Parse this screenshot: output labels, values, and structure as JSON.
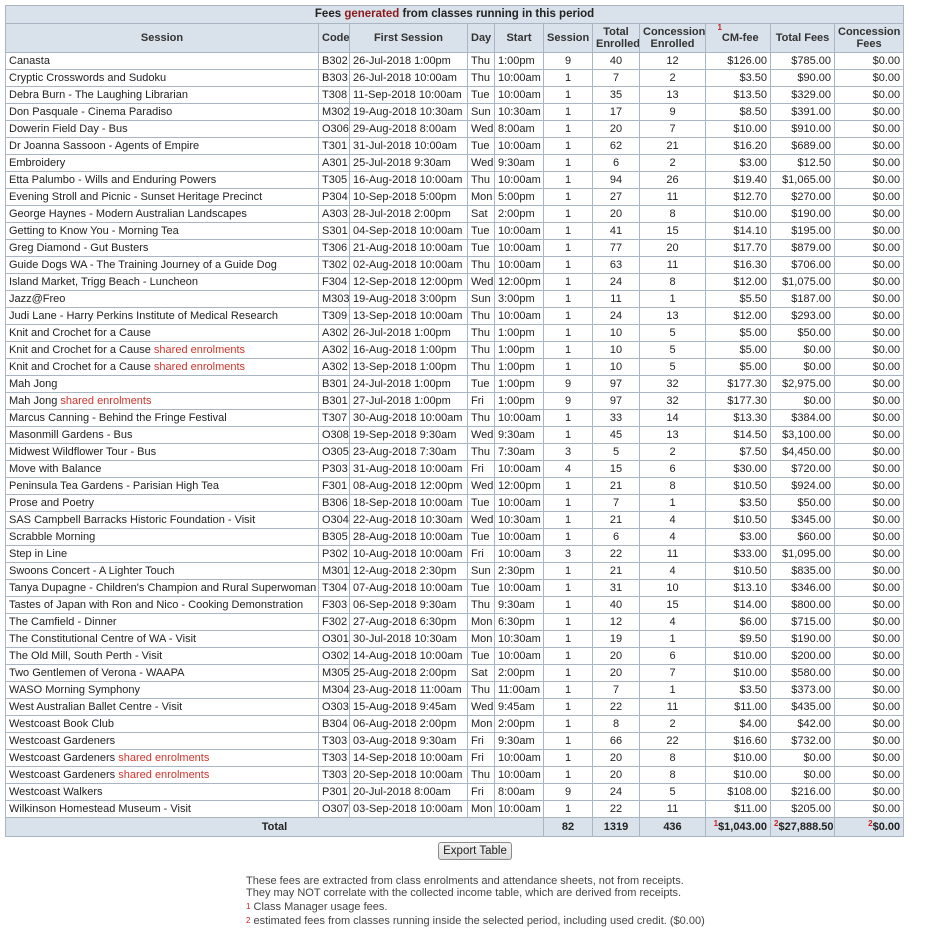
{
  "title": {
    "prefix": "Fees ",
    "highlight": "generated",
    "suffix": " from classes running in this period"
  },
  "headers": {
    "session": "Session",
    "code": "Code",
    "first_session": "First Session",
    "day": "Day",
    "start": "Start",
    "session_count": "Session",
    "total_enrolled": "Total Enrolled",
    "concession_enrolled": "Concession Enrolled",
    "cm_fee_sup": "1",
    "cm_fee": "CM-fee",
    "total_fees": "Total Fees",
    "concession_fees": "Concession Fees"
  },
  "rows": [
    {
      "name": "Canasta",
      "shared": "",
      "code": "B302",
      "first": "26-Jul-2018 1:00pm",
      "day": "Thu",
      "start": "1:00pm",
      "sessions": "9",
      "total": "40",
      "conc": "12",
      "cmfee": "$126.00",
      "fees": "$785.00",
      "concfees": "$0.00"
    },
    {
      "name": "Cryptic Crosswords and Sudoku",
      "shared": "",
      "code": "B303",
      "first": "26-Jul-2018 10:00am",
      "day": "Thu",
      "start": "10:00am",
      "sessions": "1",
      "total": "7",
      "conc": "2",
      "cmfee": "$3.50",
      "fees": "$90.00",
      "concfees": "$0.00"
    },
    {
      "name": "Debra Burn - The Laughing Librarian",
      "shared": "",
      "code": "T308",
      "first": "11-Sep-2018 10:00am",
      "day": "Tue",
      "start": "10:00am",
      "sessions": "1",
      "total": "35",
      "conc": "13",
      "cmfee": "$13.50",
      "fees": "$329.00",
      "concfees": "$0.00"
    },
    {
      "name": "Don Pasquale - Cinema Paradiso",
      "shared": "",
      "code": "M302",
      "first": "19-Aug-2018 10:30am",
      "day": "Sun",
      "start": "10:30am",
      "sessions": "1",
      "total": "17",
      "conc": "9",
      "cmfee": "$8.50",
      "fees": "$391.00",
      "concfees": "$0.00"
    },
    {
      "name": "Dowerin Field Day - Bus",
      "shared": "",
      "code": "O306",
      "first": "29-Aug-2018 8:00am",
      "day": "Wed",
      "start": "8:00am",
      "sessions": "1",
      "total": "20",
      "conc": "7",
      "cmfee": "$10.00",
      "fees": "$910.00",
      "concfees": "$0.00"
    },
    {
      "name": "Dr Joanna Sassoon - Agents of Empire",
      "shared": "",
      "code": "T301",
      "first": "31-Jul-2018 10:00am",
      "day": "Tue",
      "start": "10:00am",
      "sessions": "1",
      "total": "62",
      "conc": "21",
      "cmfee": "$16.20",
      "fees": "$689.00",
      "concfees": "$0.00"
    },
    {
      "name": "Embroidery",
      "shared": "",
      "code": "A301",
      "first": "25-Jul-2018 9:30am",
      "day": "Wed",
      "start": "9:30am",
      "sessions": "1",
      "total": "6",
      "conc": "2",
      "cmfee": "$3.00",
      "fees": "$12.50",
      "concfees": "$0.00"
    },
    {
      "name": "Etta Palumbo - Wills and Enduring Powers",
      "shared": "",
      "code": "T305",
      "first": "16-Aug-2018 10:00am",
      "day": "Thu",
      "start": "10:00am",
      "sessions": "1",
      "total": "94",
      "conc": "26",
      "cmfee": "$19.40",
      "fees": "$1,065.00",
      "concfees": "$0.00"
    },
    {
      "name": "Evening Stroll and Picnic - Sunset Heritage Precinct",
      "shared": "",
      "code": "P304",
      "first": "10-Sep-2018 5:00pm",
      "day": "Mon",
      "start": "5:00pm",
      "sessions": "1",
      "total": "27",
      "conc": "11",
      "cmfee": "$12.70",
      "fees": "$270.00",
      "concfees": "$0.00"
    },
    {
      "name": "George Haynes - Modern Australian Landscapes",
      "shared": "",
      "code": "A303",
      "first": "28-Jul-2018 2:00pm",
      "day": "Sat",
      "start": "2:00pm",
      "sessions": "1",
      "total": "20",
      "conc": "8",
      "cmfee": "$10.00",
      "fees": "$190.00",
      "concfees": "$0.00"
    },
    {
      "name": "Getting to Know You - Morning Tea",
      "shared": "",
      "code": "S301",
      "first": "04-Sep-2018 10:00am",
      "day": "Tue",
      "start": "10:00am",
      "sessions": "1",
      "total": "41",
      "conc": "15",
      "cmfee": "$14.10",
      "fees": "$195.00",
      "concfees": "$0.00"
    },
    {
      "name": "Greg Diamond - Gut Busters",
      "shared": "",
      "code": "T306",
      "first": "21-Aug-2018 10:00am",
      "day": "Tue",
      "start": "10:00am",
      "sessions": "1",
      "total": "77",
      "conc": "20",
      "cmfee": "$17.70",
      "fees": "$879.00",
      "concfees": "$0.00"
    },
    {
      "name": "Guide Dogs WA - The Training Journey of a Guide Dog",
      "shared": "",
      "code": "T302",
      "first": "02-Aug-2018 10:00am",
      "day": "Thu",
      "start": "10:00am",
      "sessions": "1",
      "total": "63",
      "conc": "11",
      "cmfee": "$16.30",
      "fees": "$706.00",
      "concfees": "$0.00"
    },
    {
      "name": "Island Market, Trigg Beach - Luncheon",
      "shared": "",
      "code": "F304",
      "first": "12-Sep-2018 12:00pm",
      "day": "Wed",
      "start": "12:00pm",
      "sessions": "1",
      "total": "24",
      "conc": "8",
      "cmfee": "$12.00",
      "fees": "$1,075.00",
      "concfees": "$0.00"
    },
    {
      "name": "Jazz@Freo",
      "shared": "",
      "code": "M303",
      "first": "19-Aug-2018 3:00pm",
      "day": "Sun",
      "start": "3:00pm",
      "sessions": "1",
      "total": "11",
      "conc": "1",
      "cmfee": "$5.50",
      "fees": "$187.00",
      "concfees": "$0.00"
    },
    {
      "name": "Judi Lane - Harry Perkins Institute of Medical Research",
      "shared": "",
      "code": "T309",
      "first": "13-Sep-2018 10:00am",
      "day": "Thu",
      "start": "10:00am",
      "sessions": "1",
      "total": "24",
      "conc": "13",
      "cmfee": "$12.00",
      "fees": "$293.00",
      "concfees": "$0.00"
    },
    {
      "name": "Knit and Crochet for a Cause",
      "shared": "",
      "code": "A302",
      "first": "26-Jul-2018 1:00pm",
      "day": "Thu",
      "start": "1:00pm",
      "sessions": "1",
      "total": "10",
      "conc": "5",
      "cmfee": "$5.00",
      "fees": "$50.00",
      "concfees": "$0.00"
    },
    {
      "name": "Knit and Crochet for a Cause",
      "shared": "shared enrolments",
      "code": "A302",
      "first": "16-Aug-2018 1:00pm",
      "day": "Thu",
      "start": "1:00pm",
      "sessions": "1",
      "total": "10",
      "conc": "5",
      "cmfee": "$5.00",
      "fees": "$0.00",
      "concfees": "$0.00"
    },
    {
      "name": "Knit and Crochet for a Cause",
      "shared": "shared enrolments",
      "code": "A302",
      "first": "13-Sep-2018 1:00pm",
      "day": "Thu",
      "start": "1:00pm",
      "sessions": "1",
      "total": "10",
      "conc": "5",
      "cmfee": "$5.00",
      "fees": "$0.00",
      "concfees": "$0.00"
    },
    {
      "name": "Mah Jong",
      "shared": "",
      "code": "B301",
      "first": "24-Jul-2018 1:00pm",
      "day": "Tue",
      "start": "1:00pm",
      "sessions": "9",
      "total": "97",
      "conc": "32",
      "cmfee": "$177.30",
      "fees": "$2,975.00",
      "concfees": "$0.00"
    },
    {
      "name": "Mah Jong",
      "shared": "shared enrolments",
      "code": "B301",
      "first": "27-Jul-2018 1:00pm",
      "day": "Fri",
      "start": "1:00pm",
      "sessions": "9",
      "total": "97",
      "conc": "32",
      "cmfee": "$177.30",
      "fees": "$0.00",
      "concfees": "$0.00"
    },
    {
      "name": "Marcus Canning - Behind the Fringe Festival",
      "shared": "",
      "code": "T307",
      "first": "30-Aug-2018 10:00am",
      "day": "Thu",
      "start": "10:00am",
      "sessions": "1",
      "total": "33",
      "conc": "14",
      "cmfee": "$13.30",
      "fees": "$384.00",
      "concfees": "$0.00"
    },
    {
      "name": "Masonmill Gardens - Bus",
      "shared": "",
      "code": "O308",
      "first": "19-Sep-2018 9:30am",
      "day": "Wed",
      "start": "9:30am",
      "sessions": "1",
      "total": "45",
      "conc": "13",
      "cmfee": "$14.50",
      "fees": "$3,100.00",
      "concfees": "$0.00"
    },
    {
      "name": "Midwest Wildflower Tour - Bus",
      "shared": "",
      "code": "O305",
      "first": "23-Aug-2018 7:30am",
      "day": "Thu",
      "start": "7:30am",
      "sessions": "3",
      "total": "5",
      "conc": "2",
      "cmfee": "$7.50",
      "fees": "$4,450.00",
      "concfees": "$0.00"
    },
    {
      "name": "Move with Balance",
      "shared": "",
      "code": "P303",
      "first": "31-Aug-2018 10:00am",
      "day": "Fri",
      "start": "10:00am",
      "sessions": "4",
      "total": "15",
      "conc": "6",
      "cmfee": "$30.00",
      "fees": "$720.00",
      "concfees": "$0.00"
    },
    {
      "name": "Peninsula Tea Gardens - Parisian High Tea",
      "shared": "",
      "code": "F301",
      "first": "08-Aug-2018 12:00pm",
      "day": "Wed",
      "start": "12:00pm",
      "sessions": "1",
      "total": "21",
      "conc": "8",
      "cmfee": "$10.50",
      "fees": "$924.00",
      "concfees": "$0.00"
    },
    {
      "name": "Prose and Poetry",
      "shared": "",
      "code": "B306",
      "first": "18-Sep-2018 10:00am",
      "day": "Tue",
      "start": "10:00am",
      "sessions": "1",
      "total": "7",
      "conc": "1",
      "cmfee": "$3.50",
      "fees": "$50.00",
      "concfees": "$0.00"
    },
    {
      "name": "SAS Campbell Barracks Historic Foundation - Visit",
      "shared": "",
      "code": "O304",
      "first": "22-Aug-2018 10:30am",
      "day": "Wed",
      "start": "10:30am",
      "sessions": "1",
      "total": "21",
      "conc": "4",
      "cmfee": "$10.50",
      "fees": "$345.00",
      "concfees": "$0.00"
    },
    {
      "name": "Scrabble Morning",
      "shared": "",
      "code": "B305",
      "first": "28-Aug-2018 10:00am",
      "day": "Tue",
      "start": "10:00am",
      "sessions": "1",
      "total": "6",
      "conc": "4",
      "cmfee": "$3.00",
      "fees": "$60.00",
      "concfees": "$0.00"
    },
    {
      "name": "Step in Line",
      "shared": "",
      "code": "P302",
      "first": "10-Aug-2018 10:00am",
      "day": "Fri",
      "start": "10:00am",
      "sessions": "3",
      "total": "22",
      "conc": "11",
      "cmfee": "$33.00",
      "fees": "$1,095.00",
      "concfees": "$0.00"
    },
    {
      "name": "Swoons Concert - A Lighter Touch",
      "shared": "",
      "code": "M301",
      "first": "12-Aug-2018 2:30pm",
      "day": "Sun",
      "start": "2:30pm",
      "sessions": "1",
      "total": "21",
      "conc": "4",
      "cmfee": "$10.50",
      "fees": "$835.00",
      "concfees": "$0.00"
    },
    {
      "name": "Tanya Dupagne - Children's Champion and Rural Superwoman",
      "shared": "",
      "code": "T304",
      "first": "07-Aug-2018 10:00am",
      "day": "Tue",
      "start": "10:00am",
      "sessions": "1",
      "total": "31",
      "conc": "10",
      "cmfee": "$13.10",
      "fees": "$346.00",
      "concfees": "$0.00"
    },
    {
      "name": "Tastes of Japan with Ron and Nico - Cooking Demonstration",
      "shared": "",
      "code": "F303",
      "first": "06-Sep-2018 9:30am",
      "day": "Thu",
      "start": "9:30am",
      "sessions": "1",
      "total": "40",
      "conc": "15",
      "cmfee": "$14.00",
      "fees": "$800.00",
      "concfees": "$0.00"
    },
    {
      "name": "The Camfield - Dinner",
      "shared": "",
      "code": "F302",
      "first": "27-Aug-2018 6:30pm",
      "day": "Mon",
      "start": "6:30pm",
      "sessions": "1",
      "total": "12",
      "conc": "4",
      "cmfee": "$6.00",
      "fees": "$715.00",
      "concfees": "$0.00"
    },
    {
      "name": "The Constitutional Centre of WA - Visit",
      "shared": "",
      "code": "O301",
      "first": "30-Jul-2018 10:30am",
      "day": "Mon",
      "start": "10:30am",
      "sessions": "1",
      "total": "19",
      "conc": "1",
      "cmfee": "$9.50",
      "fees": "$190.00",
      "concfees": "$0.00"
    },
    {
      "name": "The Old Mill, South Perth - Visit",
      "shared": "",
      "code": "O302",
      "first": "14-Aug-2018 10:00am",
      "day": "Tue",
      "start": "10:00am",
      "sessions": "1",
      "total": "20",
      "conc": "6",
      "cmfee": "$10.00",
      "fees": "$200.00",
      "concfees": "$0.00"
    },
    {
      "name": "Two Gentlemen of Verona - WAAPA",
      "shared": "",
      "code": "M305",
      "first": "25-Aug-2018 2:00pm",
      "day": "Sat",
      "start": "2:00pm",
      "sessions": "1",
      "total": "20",
      "conc": "7",
      "cmfee": "$10.00",
      "fees": "$580.00",
      "concfees": "$0.00"
    },
    {
      "name": "WASO Morning Symphony",
      "shared": "",
      "code": "M304",
      "first": "23-Aug-2018 11:00am",
      "day": "Thu",
      "start": "11:00am",
      "sessions": "1",
      "total": "7",
      "conc": "1",
      "cmfee": "$3.50",
      "fees": "$373.00",
      "concfees": "$0.00"
    },
    {
      "name": "West Australian Ballet Centre - Visit",
      "shared": "",
      "code": "O303",
      "first": "15-Aug-2018 9:45am",
      "day": "Wed",
      "start": "9:45am",
      "sessions": "1",
      "total": "22",
      "conc": "11",
      "cmfee": "$11.00",
      "fees": "$435.00",
      "concfees": "$0.00"
    },
    {
      "name": "Westcoast Book Club",
      "shared": "",
      "code": "B304",
      "first": "06-Aug-2018 2:00pm",
      "day": "Mon",
      "start": "2:00pm",
      "sessions": "1",
      "total": "8",
      "conc": "2",
      "cmfee": "$4.00",
      "fees": "$42.00",
      "concfees": "$0.00"
    },
    {
      "name": "Westcoast Gardeners",
      "shared": "",
      "code": "T303",
      "first": "03-Aug-2018 9:30am",
      "day": "Fri",
      "start": "9:30am",
      "sessions": "1",
      "total": "66",
      "conc": "22",
      "cmfee": "$16.60",
      "fees": "$732.00",
      "concfees": "$0.00"
    },
    {
      "name": "Westcoast Gardeners",
      "shared": "shared enrolments",
      "code": "T303",
      "first": "14-Sep-2018 10:00am",
      "day": "Fri",
      "start": "10:00am",
      "sessions": "1",
      "total": "20",
      "conc": "8",
      "cmfee": "$10.00",
      "fees": "$0.00",
      "concfees": "$0.00"
    },
    {
      "name": "Westcoast Gardeners",
      "shared": "shared enrolments",
      "code": "T303",
      "first": "20-Sep-2018 10:00am",
      "day": "Thu",
      "start": "10:00am",
      "sessions": "1",
      "total": "20",
      "conc": "8",
      "cmfee": "$10.00",
      "fees": "$0.00",
      "concfees": "$0.00"
    },
    {
      "name": "Westcoast Walkers",
      "shared": "",
      "code": "P301",
      "first": "20-Jul-2018 8:00am",
      "day": "Fri",
      "start": "8:00am",
      "sessions": "9",
      "total": "24",
      "conc": "5",
      "cmfee": "$108.00",
      "fees": "$216.00",
      "concfees": "$0.00"
    },
    {
      "name": "Wilkinson Homestead Museum - Visit",
      "shared": "",
      "code": "O307",
      "first": "03-Sep-2018 10:00am",
      "day": "Mon",
      "start": "10:00am",
      "sessions": "1",
      "total": "22",
      "conc": "11",
      "cmfee": "$11.00",
      "fees": "$205.00",
      "concfees": "$0.00"
    }
  ],
  "totals": {
    "label": "Total",
    "sessions": "82",
    "total_enrolled": "1319",
    "concession_enrolled": "436",
    "cmfee_sup": "1",
    "cmfee": "$1,043.00",
    "fees_sup": "2",
    "fees": "$27,888.50",
    "concfees_sup": "2",
    "concfees": "$0.00"
  },
  "export_button": "Export Table",
  "notes": {
    "line1": "These fees are extracted from class enrolments and attendance sheets, not from receipts.",
    "line2": "They may NOT correlate with the collected income table, which are derived from receipts.",
    "fn1_num": "1",
    "fn1_text": " Class Manager usage fees.",
    "fn2_num": "2",
    "fn2_text": " estimated fees from classes running inside the selected period, including used credit. ($0.00)"
  },
  "colors": {
    "header_bg": "#d9e1ea",
    "border": "#a9b5c3",
    "shared_text": "#d0342c",
    "footnote_num": "#cc1e1e"
  }
}
